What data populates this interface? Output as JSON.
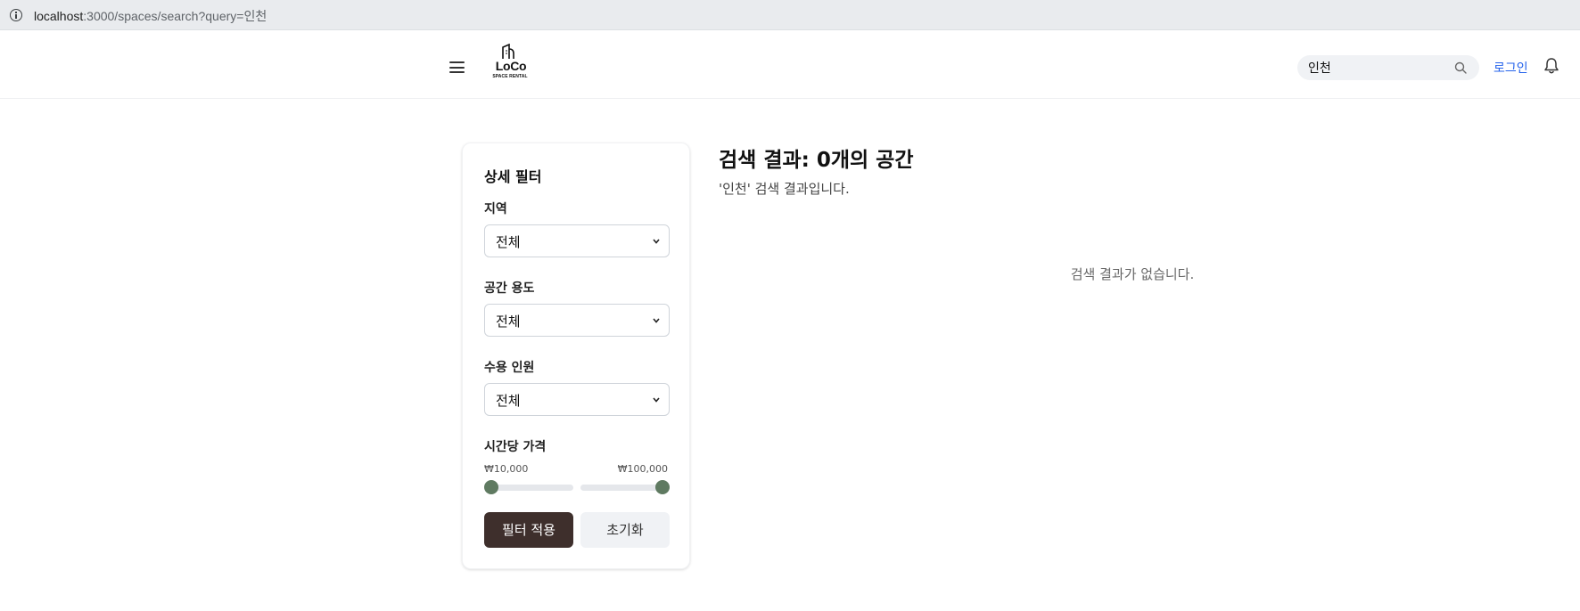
{
  "browser": {
    "url_host": "localhost",
    "url_rest": ":3000/spaces/search?query=인천"
  },
  "header": {
    "logo_name": "LoCo",
    "logo_sub": "SPACE RENTAL",
    "search_value": "인천",
    "login_label": "로그인"
  },
  "filter": {
    "title": "상세 필터",
    "region_label": "지역",
    "region_value": "전체",
    "purpose_label": "공간 용도",
    "purpose_value": "전체",
    "capacity_label": "수용 인원",
    "capacity_value": "전체",
    "price_label": "시간당 가격",
    "price_min": "₩10,000",
    "price_max": "₩100,000",
    "apply_label": "필터 적용",
    "reset_label": "초기화"
  },
  "results": {
    "title": "검색 결과: 0개의 공간",
    "subtitle": "'인천' 검색 결과입니다.",
    "empty_message": "검색 결과가 없습니다."
  },
  "colors": {
    "accent_link": "#2563eb",
    "apply_button": "#3e2f2c",
    "slider_thumb": "#5f7a61"
  },
  "icons": [
    "info-icon",
    "menu-icon",
    "search-icon",
    "bell-icon",
    "chevron-down-icon"
  ]
}
